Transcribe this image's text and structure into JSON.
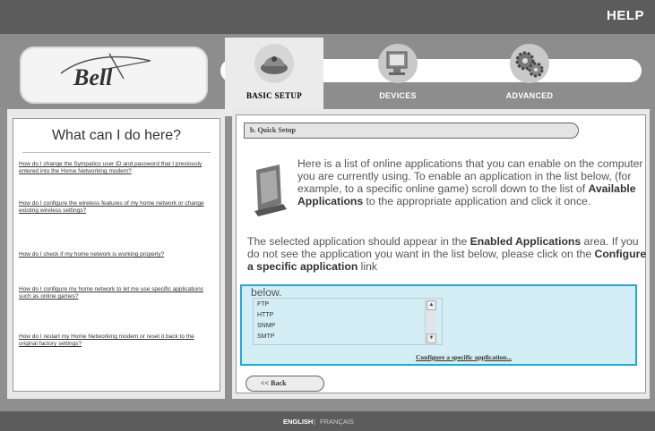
{
  "header": {
    "help_label": "HELP"
  },
  "brand": {
    "logo_text": "Bell"
  },
  "tabs": [
    {
      "label": "BASIC SETUP",
      "icon": "router-icon",
      "active": true
    },
    {
      "label": "DEVICES",
      "icon": "monitor-icon",
      "active": false
    },
    {
      "label": "ADVANCED",
      "icon": "gears-icon",
      "active": false
    }
  ],
  "help_panel": {
    "title": "What can I do here?",
    "links": [
      "How do I change the Sympatico user ID and password that I previously entered into the Home Networking modem?",
      "How do I configure the wireless features of my home network or change existing wireless settings?",
      "How do I check if my home network is working properly?",
      "How do I configure my home network to let me use specific applications such as online games?",
      "How do I restart my Home Networking modem or reset it back to the original factory settings?"
    ]
  },
  "main": {
    "section_title": "b. Quick Setup",
    "intro_parts": [
      "Here is a list of online applications that you can enable on the computer you are currently using. To enable an application in the list below, (for example, to a specific online game) scroll down to the list of ",
      "Available Applications",
      " to the appropriate application and click it once."
    ],
    "intro2_parts": [
      "The selected application should appear in the ",
      "Enabled Applications",
      " area. If you do not see the application you want in the list below, please click on the ",
      "Configure a specific application",
      " link"
    ],
    "below_text": "below.",
    "app_list": [
      "FTP",
      "HTTP",
      "SNMP",
      "SMTP"
    ],
    "configure_link": "Configure a specific application...",
    "back_label": "<< Back",
    "highlight_color": "#23a6d8"
  },
  "footer": {
    "english": "ENGLISH",
    "separator": "|",
    "french": "FRANÇAIS"
  }
}
